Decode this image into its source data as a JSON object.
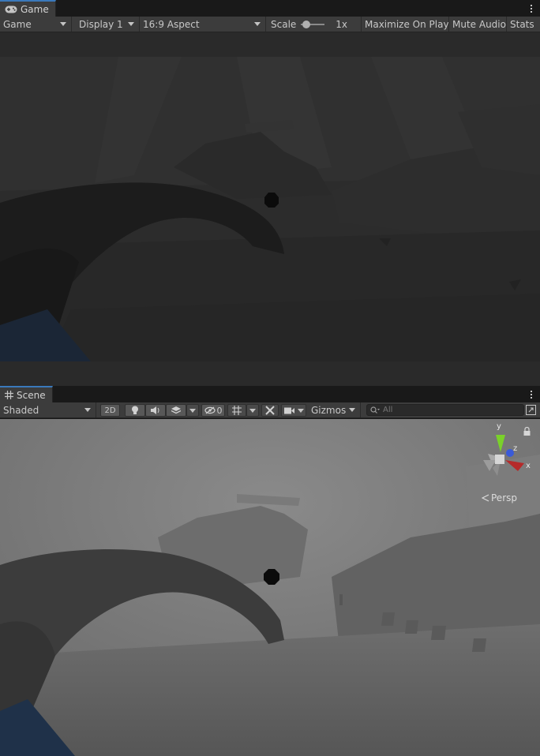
{
  "game_panel": {
    "tab_label": "Game",
    "tab_icon": "gamepad-icon",
    "display_mode": "Game",
    "display": "Display 1",
    "aspect": "16:9 Aspect",
    "scale_label": "Scale",
    "scale_value": "1x",
    "scale_fraction": 0.08,
    "maximize_label": "Maximize On Play",
    "mute_label": "Mute Audio",
    "stats_label": "Stats"
  },
  "scene_panel": {
    "tab_label": "Scene",
    "tab_icon": "grid-icon",
    "draw_mode": "Shaded",
    "mode_2d": "2D",
    "hidden_count": "0",
    "gizmos_label": "Gizmos",
    "search_placeholder": "All",
    "gizmo": {
      "y_label": "y",
      "x_label": "x",
      "z_label": "z",
      "projection_label": "Persp"
    }
  },
  "colors": {
    "chrome": "#3c3c3c",
    "tab_accent": "#3a79bb",
    "axis_x": "#b52a2a",
    "axis_y": "#7ad12a",
    "axis_z": "#3a5bd9"
  }
}
